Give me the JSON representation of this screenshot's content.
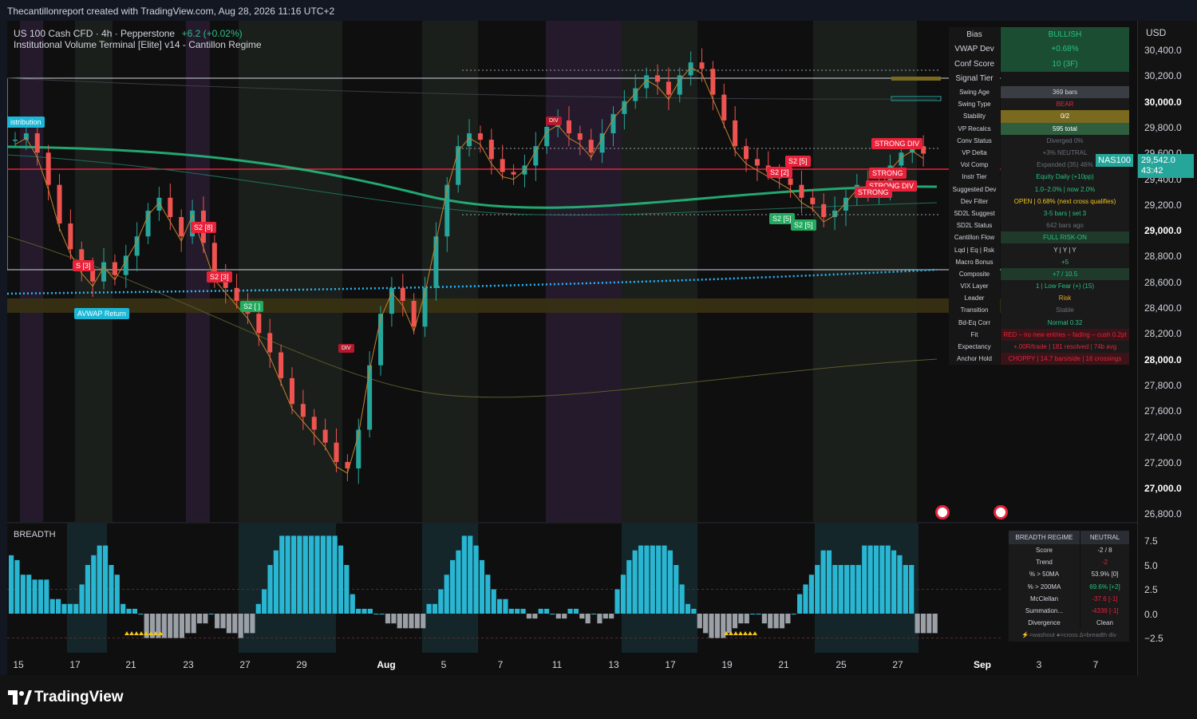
{
  "header": {
    "attribution": "Thecantillonreport created with TradingView.com, Aug 28, 2026 11:16 UTC+2",
    "symbol": "US 100 Cash CFD · 4h · Pepperstone",
    "change": "+6.2 (+0.02%)",
    "indicator": "Institutional Volume Terminal [Elite] v14 - Cantillon Regime",
    "change_color": "#2ebd85"
  },
  "price_axis": {
    "currency": "USD",
    "labels": [
      "30,400.0",
      "30,200.0",
      "30,000.0",
      "29,800.0",
      "29,600.0",
      "29,400.0",
      "29,200.0",
      "29,000.0",
      "28,800.0",
      "28,600.0",
      "28,400.0",
      "28,200.0",
      "28,000.0",
      "27,800.0",
      "27,600.0",
      "27,400.0",
      "27,200.0",
      "27,000.0",
      "26,800.0"
    ],
    "bold_labels": [
      "30,000.0",
      "29,000.0",
      "28,000.0",
      "27,000.0"
    ],
    "current_symbol": "NAS100",
    "current_price": "29,542.0",
    "countdown": "43:42"
  },
  "breadth_axis": {
    "labels": [
      "7.5",
      "5.0",
      "2.5",
      "0.0",
      "−2.5"
    ]
  },
  "time_axis": {
    "labels": [
      "15",
      "17",
      "21",
      "23",
      "27",
      "29",
      "Aug",
      "5",
      "7",
      "11",
      "13",
      "17",
      "19",
      "21",
      "25",
      "27",
      "Sep",
      "3",
      "7"
    ],
    "bold": [
      "Aug",
      "Sep"
    ]
  },
  "info_table": {
    "header_rows": [
      {
        "k": "Bias",
        "v": "BULLISH",
        "color": "#26c281",
        "bg": "#1b4d33"
      },
      {
        "k": "VWAP Dev",
        "v": "+0.68%",
        "color": "#26c281",
        "bg": "#1b4d33"
      },
      {
        "k": "Conf Score",
        "v": "10 (3F)",
        "color": "#26c281",
        "bg": "#1b4d33"
      },
      {
        "k": "Signal Tier",
        "v": "",
        "color": "#d1d4dc",
        "bg": "#161616"
      }
    ],
    "rows": [
      {
        "k": "Swing Age",
        "v": "369 bars",
        "color": "#d1d4dc",
        "bg": "#3a3d44"
      },
      {
        "k": "Swing Type",
        "v": "BEAR",
        "color": "#e8223a",
        "bg": "#1a1a1a"
      },
      {
        "k": "Stability",
        "v": "0/2",
        "color": "#ffffff",
        "bg": "#7a6a1f"
      },
      {
        "k": "VP Recalcs",
        "v": "595 total",
        "color": "#ffffff",
        "bg": "#2f5e3f"
      },
      {
        "k": "Conv Status",
        "v": "Diverged 0%",
        "color": "#6b6f78",
        "bg": "#1a1a1a"
      },
      {
        "k": "VP Delta",
        "v": "+3% NEUTRAL",
        "color": "#6b6f78",
        "bg": "#1a1a1a"
      },
      {
        "k": "Vol Comp",
        "v": "Expanded (35) 46%",
        "color": "#6b6f78",
        "bg": "#1a1a1a"
      },
      {
        "k": "Instr Tier",
        "v": "Equity Daily (+10pp)",
        "color": "#26c281",
        "bg": "#1a1a1a"
      },
      {
        "k": "Suggested Dev",
        "v": "1.0–2.0% | now 2.0%",
        "color": "#26c281",
        "bg": "#1a1a1a"
      },
      {
        "k": "Dev Filter",
        "v": "OPEN | 0.68% (next cross qualifies)",
        "color": "#f5c518",
        "bg": "#1a1a1a"
      },
      {
        "k": "SD2L Suggest",
        "v": "3-5 bars | set 3",
        "color": "#26c281",
        "bg": "#1a1a1a"
      },
      {
        "k": "SD2L Status",
        "v": "642 bars ago",
        "color": "#6b6f78",
        "bg": "#1a1a1a"
      },
      {
        "k": "Cantillon Flow",
        "v": "FULL RISK-ON",
        "color": "#26c281",
        "bg": "#1f3a2a"
      },
      {
        "k": "Lqd | Eq | Rsk",
        "v": "Y | Y | Y",
        "color": "#d1d4dc",
        "bg": "#1a1a1a"
      },
      {
        "k": "Macro Bonus",
        "v": "+5",
        "color": "#26c281",
        "bg": "#1a1a1a"
      },
      {
        "k": "Composite",
        "v": "+7 / 10.5",
        "color": "#26c281",
        "bg": "#1f3a2a"
      },
      {
        "k": "VIX Layer",
        "v": "1 | Low Fear (+) (15)",
        "color": "#26c281",
        "bg": "#1a1a1a"
      },
      {
        "k": "Leader",
        "v": "Risk",
        "color": "#f5a623",
        "bg": "#1a1a1a"
      },
      {
        "k": "Transition",
        "v": "Stable",
        "color": "#6b6f78",
        "bg": "#1a1a1a"
      },
      {
        "k": "Bd-Eq Corr",
        "v": "Normal 0.32",
        "color": "#26c281",
        "bg": "#1a1a1a"
      },
      {
        "k": "Fit",
        "v": "RED – no new entries – fading – cush 0.2pt",
        "color": "#e8223a",
        "bg": "#3a1418"
      },
      {
        "k": "Expectancy",
        "v": "+.00R/trade | 181 resolved | 74b avg",
        "color": "#e8223a",
        "bg": "#1a1a1a"
      },
      {
        "k": "Anchor Hold",
        "v": "CHOPPY | 14.7 bars/side | 16 crossings",
        "color": "#e8223a",
        "bg": "#3a1418"
      }
    ]
  },
  "breadth_panel": {
    "title": "BREADTH",
    "legend": "⚡=washout  ●=cross  ∆=breadth div",
    "table_header": {
      "k": "BREADTH REGIME",
      "v": "NEUTRAL"
    },
    "rows": [
      {
        "k": "Score",
        "v": "-2 / 8",
        "color": "#d1d4dc"
      },
      {
        "k": "Trend",
        "v": "-2",
        "color": "#e8223a"
      },
      {
        "k": "% > 50MA",
        "v": "53.9%  [0]",
        "color": "#d1d4dc"
      },
      {
        "k": "% > 200MA",
        "v": "69.6%  [+2]",
        "color": "#26c281"
      },
      {
        "k": "McClellan",
        "v": "-37.6  [-1]",
        "color": "#e8223a"
      },
      {
        "k": "Summation...",
        "v": "-4339  [-1]",
        "color": "#e8223a"
      },
      {
        "k": "Divergence",
        "v": "Clean",
        "color": "#d1d4dc"
      }
    ]
  },
  "badges": [
    {
      "text": "istribution",
      "kind": "cyan"
    },
    {
      "text": "AVWAP Return",
      "kind": "cyan"
    },
    {
      "text": "S [3]",
      "kind": "red"
    },
    {
      "text": "S2 [8]",
      "kind": "red"
    },
    {
      "text": "S2 [3]",
      "kind": "red"
    },
    {
      "text": "S2 [ ]",
      "kind": "green"
    },
    {
      "text": "DIV",
      "kind": "dred"
    },
    {
      "text": "DIV",
      "kind": "dred"
    },
    {
      "text": "S2 [5]",
      "kind": "red"
    },
    {
      "text": "S2 [2]",
      "kind": "red"
    },
    {
      "text": "S2 [5]",
      "kind": "green"
    },
    {
      "text": "S2 [5]",
      "kind": "green"
    },
    {
      "text": "STRONG DIV",
      "kind": "red"
    },
    {
      "text": "STRONG",
      "kind": "red"
    },
    {
      "text": "STRONG DIV",
      "kind": "red"
    },
    {
      "text": "STRONG",
      "kind": "red"
    }
  ],
  "branding": {
    "logo": "TradingView"
  },
  "chart_data": {
    "type": "candlestick",
    "ylim": [
      26700,
      30500
    ],
    "breadth_ylim": [
      -3.5,
      8.5
    ]
  }
}
